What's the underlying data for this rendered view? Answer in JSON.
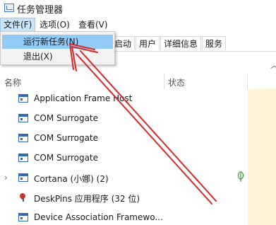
{
  "window": {
    "title": "任务管理器"
  },
  "menubar": {
    "items": [
      "文件(F)",
      "选项(O)",
      "查看(V)"
    ]
  },
  "file_menu": {
    "items": [
      "运行新任务(N)",
      "退出(X)"
    ]
  },
  "tabs": [
    "启动",
    "用户",
    "详细信息",
    "服务"
  ],
  "columns": {
    "name": "名称",
    "status": "状态"
  },
  "processes": [
    {
      "name": "Application Frame Host",
      "icon": "app-window-icon",
      "expandable": false
    },
    {
      "name": "COM Surrogate",
      "icon": "app-window-icon",
      "expandable": false
    },
    {
      "name": "COM Surrogate",
      "icon": "app-window-icon",
      "expandable": false
    },
    {
      "name": "COM Surrogate",
      "icon": "app-window-icon",
      "expandable": false
    },
    {
      "name": "Cortana (小娜) (2)",
      "icon": "app-window-icon",
      "expandable": true,
      "status_icon": "leaf-icon"
    },
    {
      "name": "DeskPins 应用程序 (32 位)",
      "icon": "pin-icon",
      "expandable": false
    },
    {
      "name": "Device Association Framewo...",
      "icon": "app-window-icon",
      "expandable": false
    }
  ],
  "annotation": {
    "arrow_color": "#d62828"
  }
}
